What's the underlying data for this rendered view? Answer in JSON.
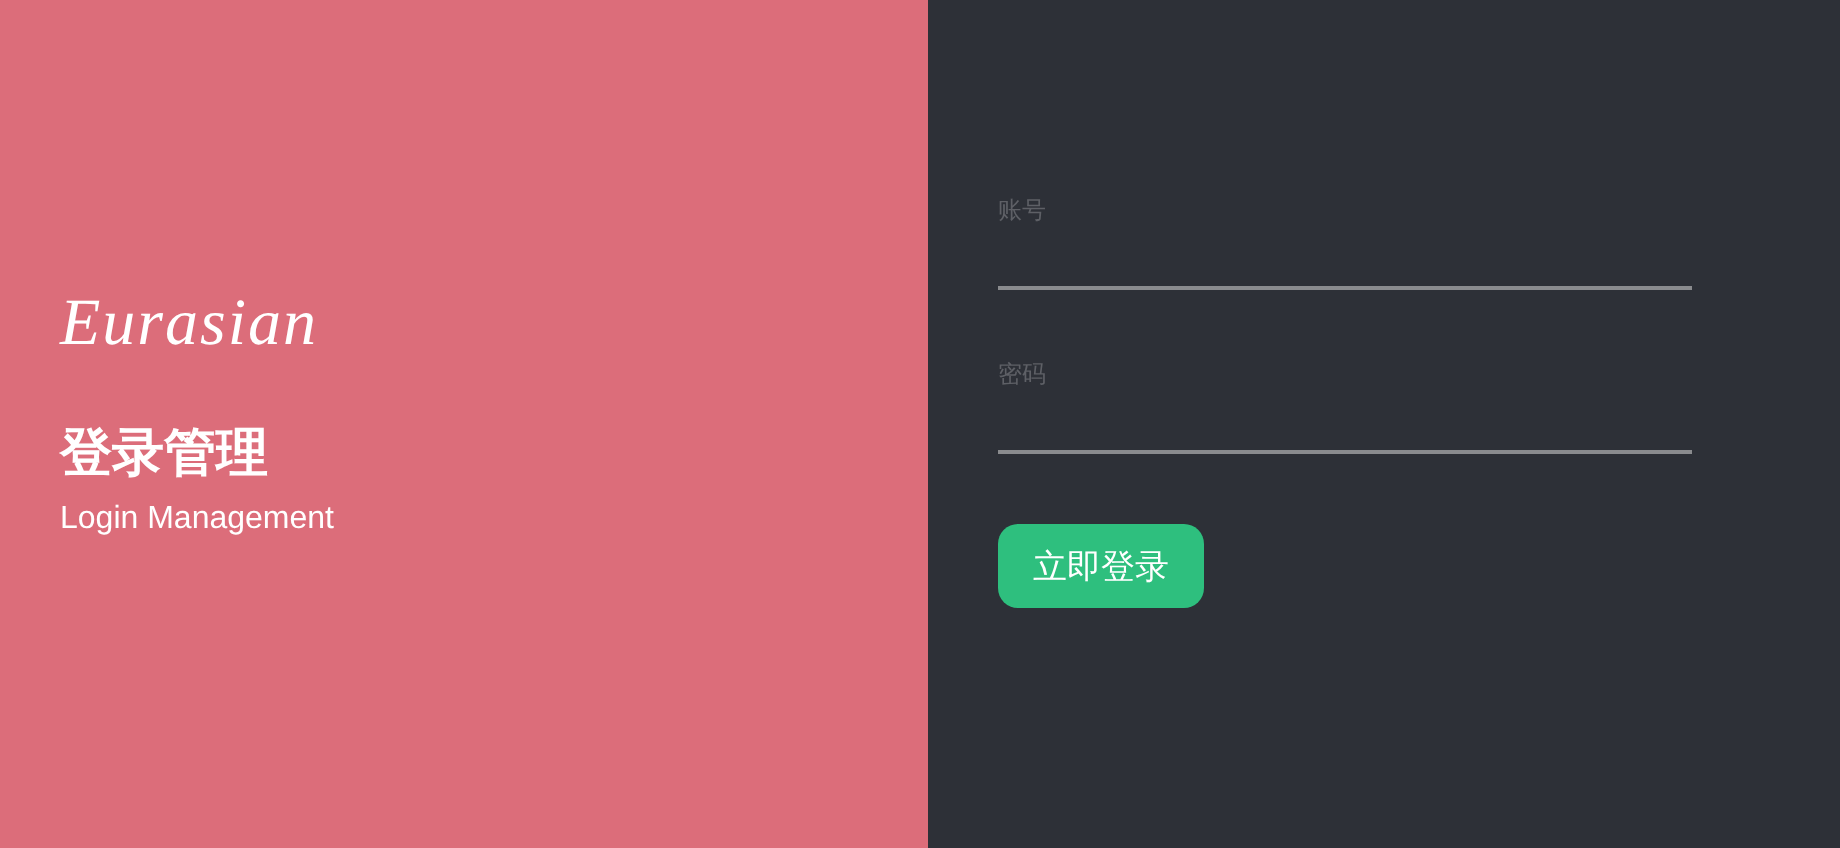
{
  "brand": {
    "logo": "Eurasian",
    "title": "登录管理",
    "subtitle": "Login Management"
  },
  "form": {
    "fields": [
      {
        "placeholder": "账号"
      },
      {
        "placeholder": "密码"
      }
    ],
    "submit": "立即登录"
  }
}
